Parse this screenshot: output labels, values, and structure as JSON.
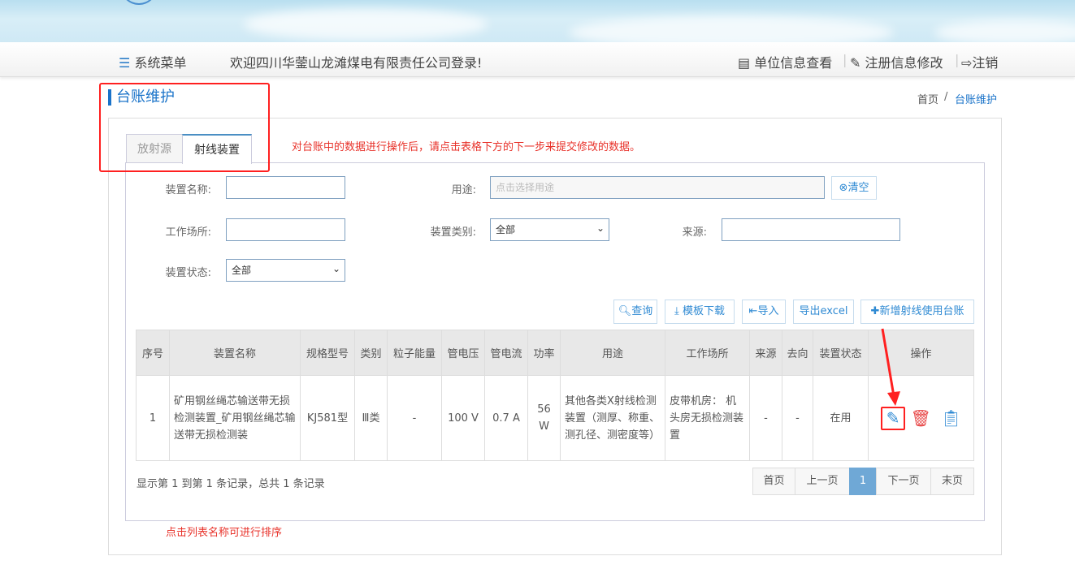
{
  "header": {
    "menu_label": "系统菜单",
    "welcome": "欢迎四川华蓥山龙滩煤电有限责任公司登录!",
    "unit_info": "单位信息查看",
    "edit_reg": "注册信息修改",
    "logout": "注销"
  },
  "page": {
    "title": "台账维护",
    "breadcrumb": [
      "首页",
      "/",
      "台账维护"
    ]
  },
  "tabs": [
    {
      "label": "放射源",
      "active": false
    },
    {
      "label": "射线装置",
      "active": true
    }
  ],
  "notice": "对台账中的数据进行操作后，请点击表格下方的下一步来提交修改的数据。",
  "form": {
    "device_name_label": "装置名称:",
    "device_name_value": "",
    "usage_label": "用途:",
    "usage_placeholder": "点击选择用途",
    "clear_label": "清空",
    "workplace_label": "工作场所:",
    "workplace_value": "",
    "category_label": "装置类别:",
    "category_value": "全部",
    "source_label": "来源:",
    "source_value": "",
    "status_label": "装置状态:",
    "status_value": "全部"
  },
  "toolbar": {
    "query": "查询",
    "template": "模板下载",
    "import": "导入",
    "export": "导出excel",
    "add": "新增射线使用台账"
  },
  "table": {
    "columns": [
      "序号",
      "装置名称",
      "规格型号",
      "类别",
      "粒子能量",
      "管电压",
      "管电流",
      "功率",
      "用途",
      "工作场所",
      "来源",
      "去向",
      "装置状态",
      "操作"
    ],
    "rows": [
      [
        "1",
        "矿用钢丝绳芯输送带无损检测装置_矿用钢丝绳芯输送带无损检测装",
        "KJ581型",
        "Ⅲ类",
        "-",
        "100 V",
        "0.7 A",
        "56 W",
        "其他各类X射线检测装置（测厚、称重、测孔径、测密度等）",
        "皮带机房： 机头房无损检测装置",
        "-",
        "-",
        "在用"
      ]
    ]
  },
  "summary": "显示第 1 到第 1 条记录，总共 1 条记录",
  "pagination": {
    "first": "首页",
    "prev": "上一页",
    "current": "1",
    "next": "下一页",
    "last": "末页"
  },
  "footer_note": "点击列表名称可进行排序",
  "colors": {
    "accent": "#1a73c9",
    "annotation": "#ff2020",
    "page_active": "#6fa8d6"
  }
}
